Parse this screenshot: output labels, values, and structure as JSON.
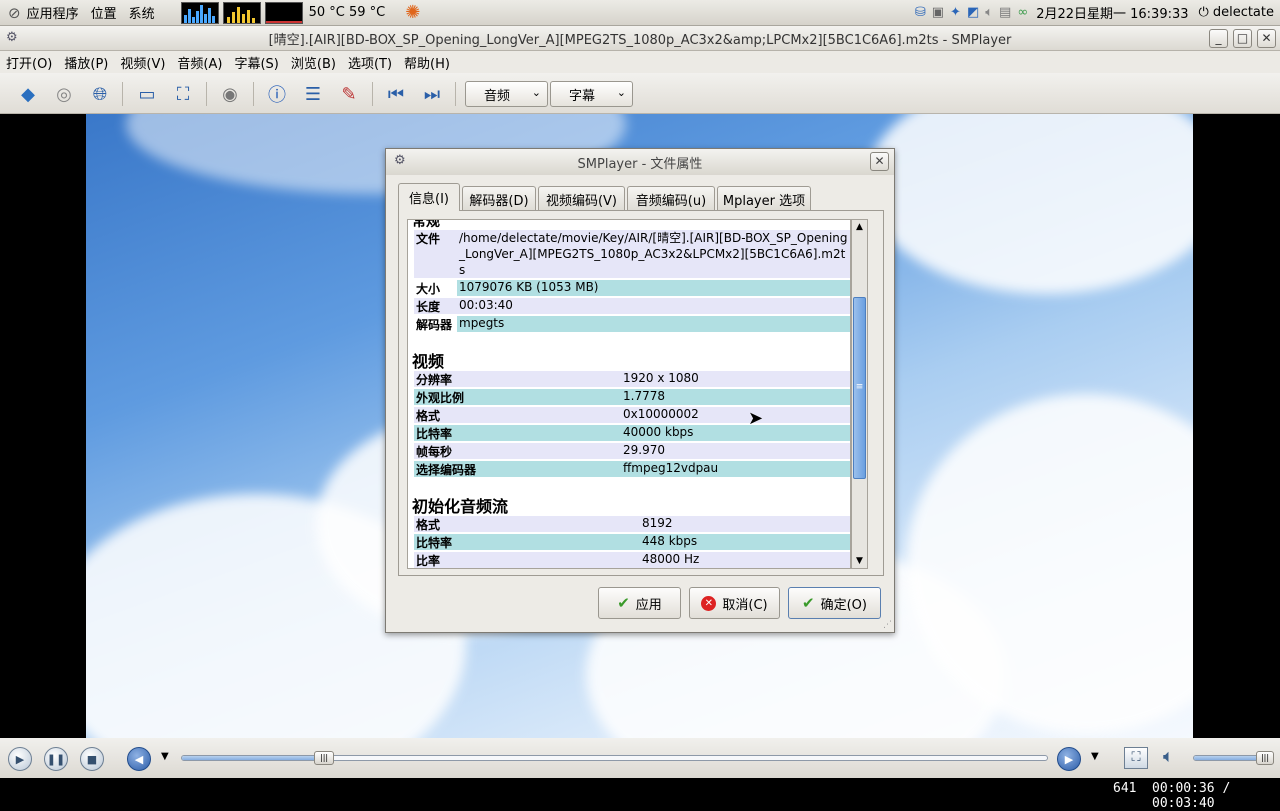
{
  "panel": {
    "apps": "应用程序",
    "places": "位置",
    "system": "系统",
    "temps": "50 °C 59 °C",
    "clock": "2月22日星期一 16:39:33",
    "user": "delectate"
  },
  "window": {
    "title": "[晴空].[AIR][BD-BOX_SP_Opening_LongVer_A][MPEG2TS_1080p_AC3x2&amp;LPCMx2][5BC1C6A6].m2ts - SMPlayer"
  },
  "menu": [
    "打开(O)",
    "播放(P)",
    "视频(V)",
    "音频(A)",
    "字幕(S)",
    "浏览(B)",
    "选项(T)",
    "帮助(H)"
  ],
  "toolbar": {
    "audio_combo": "音频",
    "subtitle_combo": "字幕"
  },
  "dialog": {
    "title": "SMPlayer - 文件属性",
    "tabs": [
      "信息(I)",
      "解码器(D)",
      "视频编码(V)",
      "音频编码(u)",
      "Mplayer 选项"
    ],
    "general_heading_partial": "常规",
    "general": [
      {
        "key": "文件",
        "value": "/home/delectate/movie/Key/AIR/[晴空].[AIR][BD-BOX_SP_Opening_LongVer_A][MPEG2TS_1080p_AC3x2&LPCMx2][5BC1C6A6].m2ts"
      },
      {
        "key": "大小",
        "value": "1079076 KB (1053 MB)"
      },
      {
        "key": "长度",
        "value": "00:03:40"
      },
      {
        "key": "解码器",
        "value": "mpegts"
      }
    ],
    "video_heading": "视频",
    "video": [
      {
        "key": "分辨率",
        "value": "1920 x 1080"
      },
      {
        "key": "外观比例",
        "value": "1.7778"
      },
      {
        "key": "格式",
        "value": "0x10000002"
      },
      {
        "key": "比特率",
        "value": "40000 kbps"
      },
      {
        "key": "帧每秒",
        "value": "29.970"
      },
      {
        "key": "选择编码器",
        "value": "ffmpeg12vdpau"
      }
    ],
    "audio_heading": "初始化音频流",
    "audio": [
      {
        "key": "格式",
        "value": "8192"
      },
      {
        "key": "比特率",
        "value": "448 kbps"
      },
      {
        "key": "比率",
        "value": "48000 Hz"
      }
    ],
    "buttons": {
      "apply": "应用",
      "cancel": "取消(C)",
      "ok": "确定(O)"
    }
  },
  "status": {
    "frame": "641",
    "time": "00:00:36 / 00:03:40"
  },
  "playback": {
    "progress": 0.165,
    "volume": 0.9
  }
}
